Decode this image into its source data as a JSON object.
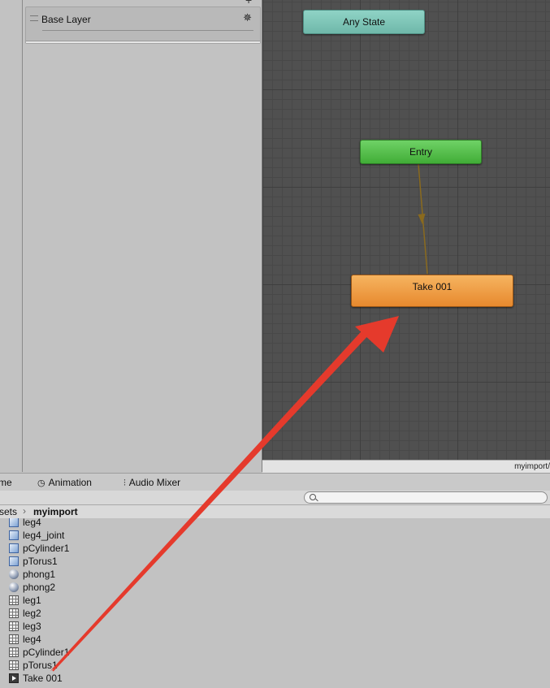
{
  "layers": {
    "add_label": "+",
    "base_layer": "Base Layer",
    "gear": "✵"
  },
  "graph": {
    "states": {
      "any_state": "Any State",
      "entry": "Entry",
      "take": "Take 001"
    },
    "path_label": "myimport/"
  },
  "tabs": {
    "game": "me",
    "animation": "Animation",
    "audio_mixer": "Audio Mixer",
    "animation_icon": "◷",
    "audio_icon": "⫶"
  },
  "project": {
    "crumb_assets": "sets",
    "crumb_sep": "›",
    "crumb_current": "myimport",
    "search_placeholder": "",
    "assets": [
      {
        "label": "leg4",
        "icon": "mesh-icon"
      },
      {
        "label": "leg4_joint",
        "icon": "mesh-icon"
      },
      {
        "label": "pCylinder1",
        "icon": "mesh-icon"
      },
      {
        "label": "pTorus1",
        "icon": "mesh-icon"
      },
      {
        "label": "phong1",
        "icon": "material-icon"
      },
      {
        "label": "phong2",
        "icon": "material-icon"
      },
      {
        "label": "leg1",
        "icon": "mesh-filter-icon"
      },
      {
        "label": "leg2",
        "icon": "mesh-filter-icon"
      },
      {
        "label": "leg3",
        "icon": "mesh-filter-icon"
      },
      {
        "label": "leg4",
        "icon": "mesh-filter-icon"
      },
      {
        "label": "pCylinder1",
        "icon": "mesh-filter-icon"
      },
      {
        "label": "pTorus1",
        "icon": "mesh-filter-icon"
      },
      {
        "label": "Take 001",
        "icon": "animation-clip-icon"
      }
    ]
  },
  "colors": {
    "any_state": "#7cc4b7",
    "entry": "#55bf4b",
    "take": "#ee9a40",
    "transition": "#8a6a1e",
    "annotation_arrow": "#e53a2c"
  }
}
